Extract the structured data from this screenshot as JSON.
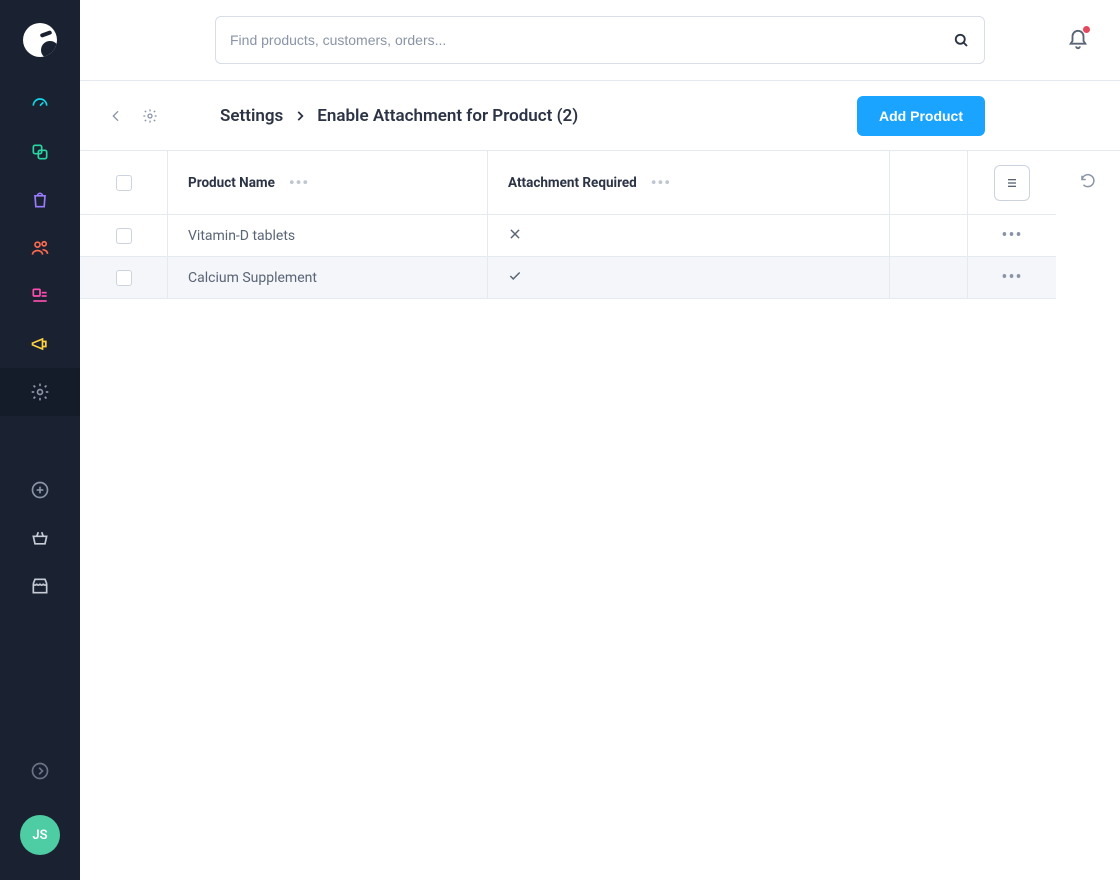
{
  "search": {
    "placeholder": "Find products, customers, orders..."
  },
  "user": {
    "initials": "JS"
  },
  "breadcrumb": {
    "root": "Settings",
    "current": "Enable Attachment for Product (2)"
  },
  "actions": {
    "add_product": "Add Product"
  },
  "table": {
    "headers": {
      "product_name": "Product Name",
      "attachment_required": "Attachment Required"
    },
    "rows": [
      {
        "product_name": "Vitamin-D tablets",
        "attachment_required": false
      },
      {
        "product_name": "Calcium Supplement",
        "attachment_required": true
      }
    ]
  },
  "sidebar": {
    "items": [
      {
        "name": "dashboard",
        "color": "#12d7e6"
      },
      {
        "name": "catalogues",
        "color": "#2ad6a0"
      },
      {
        "name": "orders",
        "color": "#9a7bff"
      },
      {
        "name": "customers",
        "color": "#ff6a4d"
      },
      {
        "name": "content",
        "color": "#ff4db0"
      },
      {
        "name": "marketing",
        "color": "#ffd23f"
      },
      {
        "name": "settings",
        "color": "#8a94a6",
        "active": true
      }
    ],
    "secondary": [
      {
        "name": "add"
      },
      {
        "name": "shopping"
      },
      {
        "name": "storefront"
      }
    ]
  },
  "colors": {
    "primary": "#1aa3ff",
    "sidebar_bg": "#1a2232"
  }
}
